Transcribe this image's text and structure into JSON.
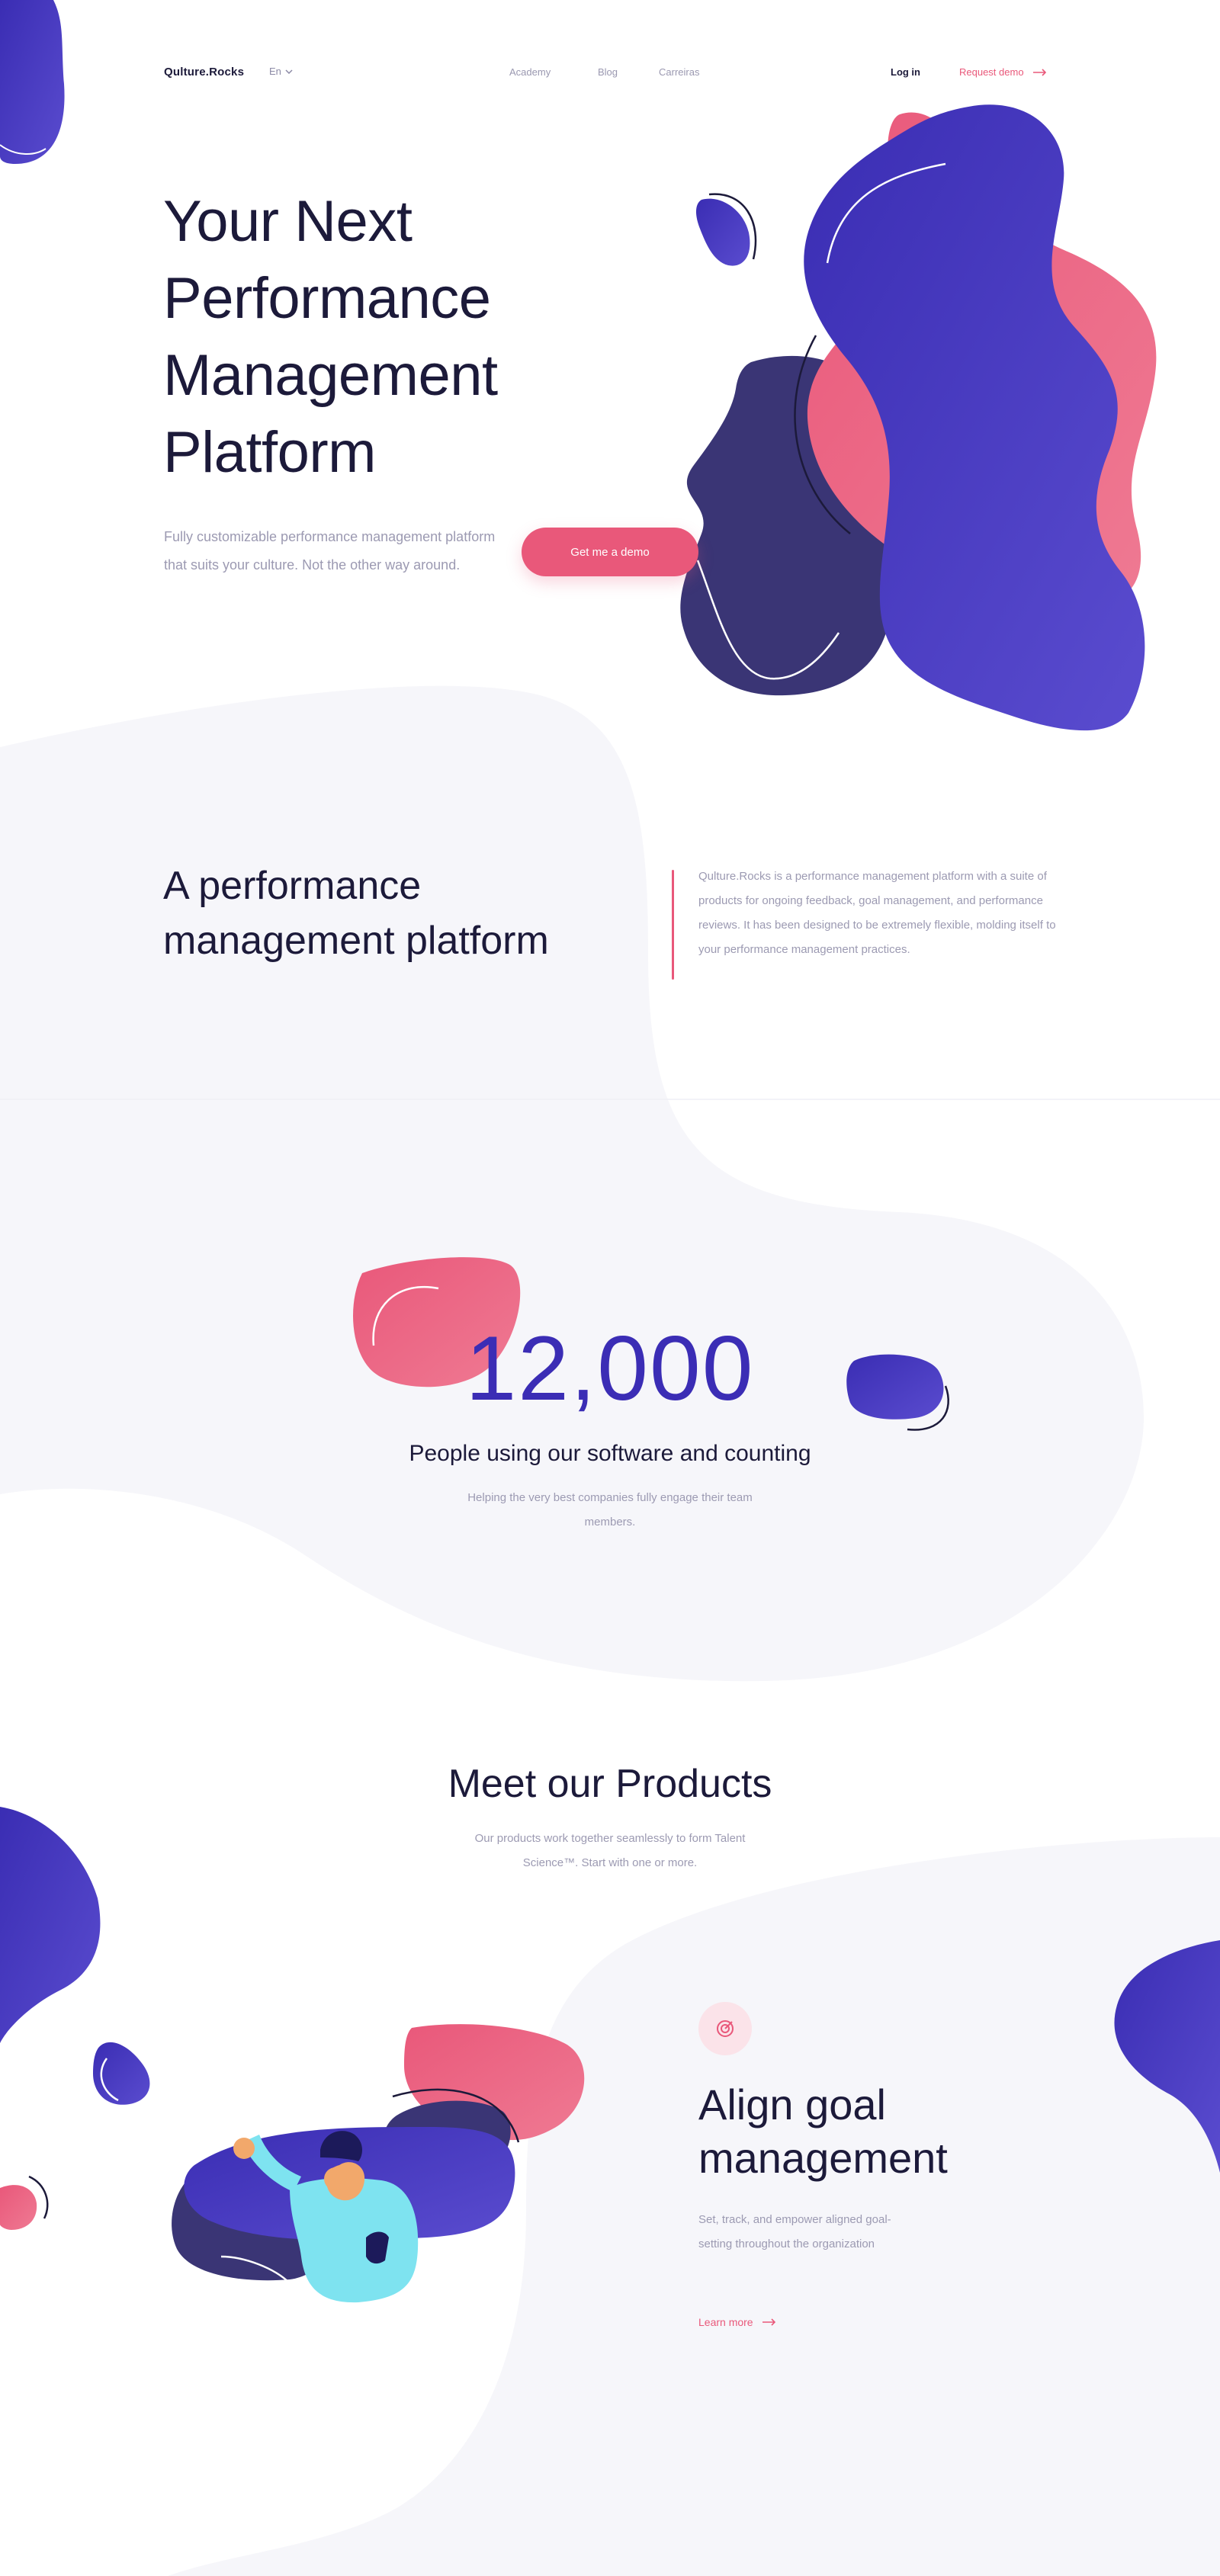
{
  "header": {
    "logo": "Qulture.Rocks",
    "language": "En",
    "nav": [
      "Academy",
      "Blog",
      "Carreiras"
    ],
    "login": "Log in",
    "request_demo": "Request demo"
  },
  "hero": {
    "title": "Your Next Performance Management Platform",
    "subtitle": "Fully customizable performance management platform that suits your culture. Not the other way around.",
    "cta": "Get me a demo"
  },
  "about": {
    "title": "A performance management platform",
    "text": "Qulture.Rocks is a performance management platform with a suite of products for ongoing feedback, goal management, and performance reviews. It has been designed to be extremely flexible, molding itself to your performance management practices."
  },
  "stats": {
    "number": "12,000",
    "label": "People using our software and counting",
    "subtitle": "Helping the very best companies fully engage their team members."
  },
  "products": {
    "title": "Meet our Products",
    "subtitle": "Our products work together seamlessly to form Talent Science™. Start with one or more.",
    "feature": {
      "icon": "target-icon",
      "title": "Align goal management",
      "text": "Set, track, and empower aligned goal-setting throughout the organization",
      "link": "Learn more"
    }
  },
  "colors": {
    "primary": "#3b2db5",
    "accent": "#e9587a",
    "dark": "#1c1a3a",
    "muted": "#9c9ab2",
    "section_bg": "#f6f6fa"
  }
}
